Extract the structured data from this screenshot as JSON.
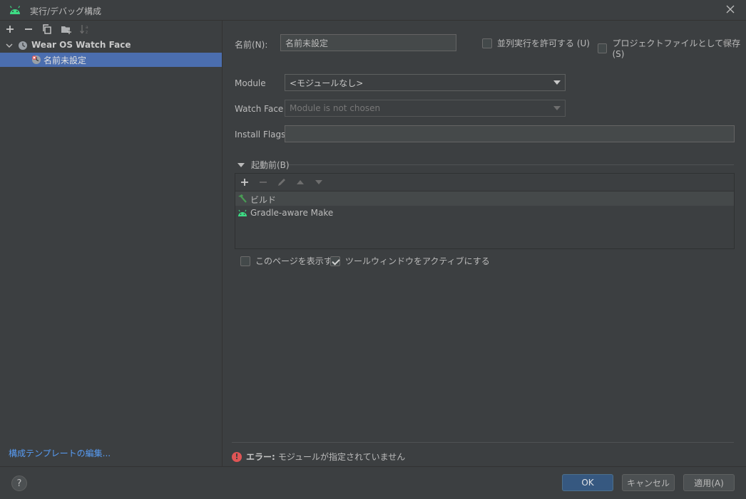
{
  "window": {
    "title": "実行/デバッグ構成"
  },
  "left": {
    "tree": [
      {
        "label": "Wear OS Watch Face",
        "expanded": true
      },
      {
        "label": "名前未設定",
        "selected": true
      }
    ],
    "template_link": "構成テンプレートの編集..."
  },
  "form": {
    "name_label": "名前(N):",
    "name_value": "名前未設定",
    "parallel_label": "並列実行を許可する (U)",
    "save_project_label": "プロジェクトファイルとして保存(S)",
    "module_label": "Module",
    "module_value": "<モジュールなし>",
    "watchface_label": "Watch Face",
    "watchface_value": "Module is not chosen",
    "install_flags_label": "Install Flags:",
    "install_flags_value": ""
  },
  "before_launch": {
    "title": "起動前(B)",
    "tasks": [
      {
        "label": "ビルド",
        "icon": "hammer-icon"
      },
      {
        "label": "Gradle-aware Make",
        "icon": "android-icon"
      }
    ],
    "show_page_label": "このページを表示する",
    "show_page_checked": false,
    "activate_tool_label": "ツールウィンドウをアクティブにする",
    "activate_tool_checked": true
  },
  "error": {
    "label": "エラー:",
    "message": "モジュールが指定されていません"
  },
  "footer": {
    "help": "?",
    "ok": "OK",
    "cancel": "キャンセル",
    "apply": "適用(A)"
  },
  "colors": {
    "background": "#3c3f41",
    "selection": "#4b6eaf",
    "link": "#589df6",
    "error": "#e05555",
    "android_green": "#3ddc84"
  }
}
